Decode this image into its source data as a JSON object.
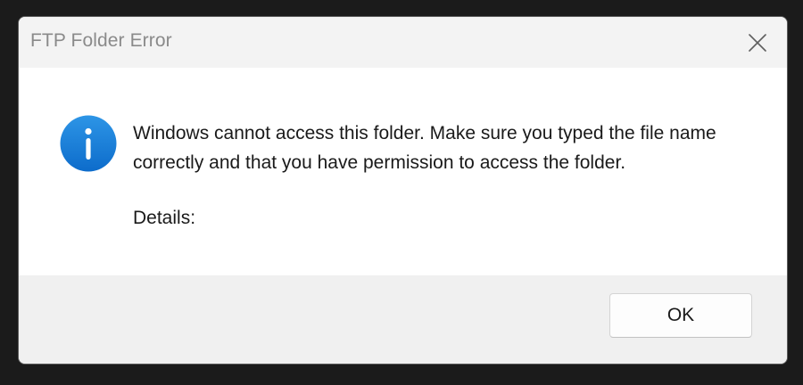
{
  "dialog": {
    "title": "FTP Folder Error",
    "close_icon": "close-icon",
    "message_icon": "info-icon",
    "message": "Windows cannot access this folder. Make sure you typed the file name correctly and that you have permission to access the folder.",
    "details_label": "Details:",
    "ok_label": "OK"
  },
  "colors": {
    "accent": "#1a7fd6",
    "background": "#1b1b1b",
    "content": "#ffffff",
    "footer": "#f0f0f0"
  }
}
